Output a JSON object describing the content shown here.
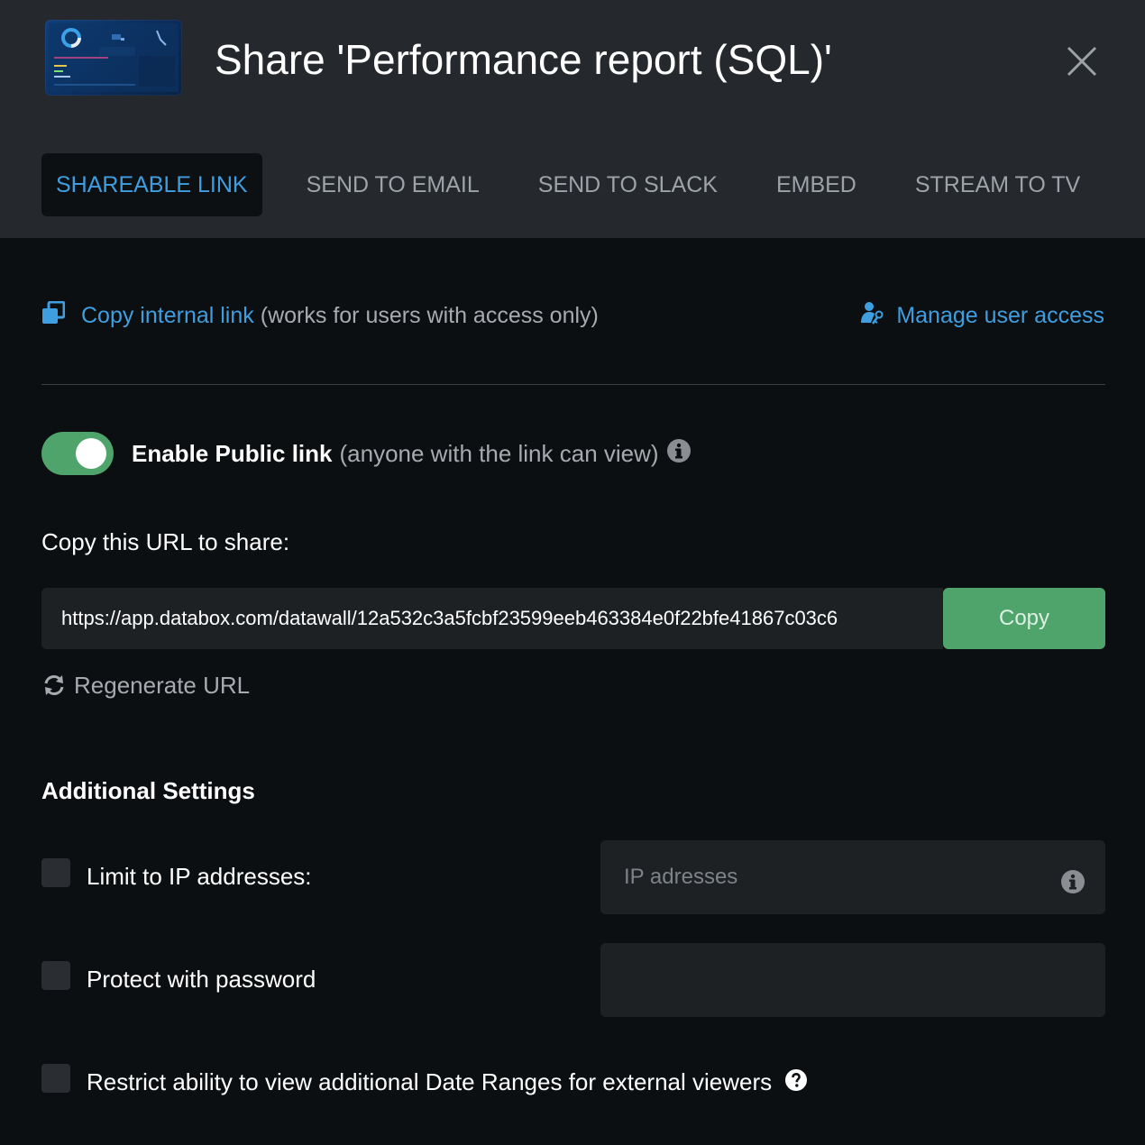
{
  "dialog": {
    "title": "Share 'Performance report (SQL)'",
    "close_icon": "close-icon",
    "thumbnail_icon": "dashboard-thumbnail"
  },
  "tabs": [
    {
      "label": "SHAREABLE LINK",
      "active": true
    },
    {
      "label": "SEND TO EMAIL",
      "active": false
    },
    {
      "label": "SEND TO SLACK",
      "active": false
    },
    {
      "label": "EMBED",
      "active": false
    },
    {
      "label": "STREAM TO TV",
      "active": false
    }
  ],
  "internal": {
    "link_label": "Copy internal link",
    "note": "(works for users with access only)",
    "icon": "copy-icon",
    "manage_label": "Manage user access",
    "manage_icon": "user-key-icon"
  },
  "public_link": {
    "enabled": true,
    "label": "Enable Public link",
    "note": "(anyone with the link can view)",
    "info_icon": "info-icon",
    "copy_url_label": "Copy this URL to share:",
    "url": "https://app.databox.com/datawall/12a532c3a5fcbf23599eeb463384e0f22bfe41867c03c6",
    "copy_button": "Copy",
    "regenerate_label": "Regenerate URL",
    "regenerate_icon": "refresh-icon"
  },
  "additional": {
    "heading": "Additional Settings",
    "ip_limit": {
      "label": "Limit to IP addresses:",
      "checked": false,
      "placeholder": "IP adresses",
      "value": "",
      "info_icon": "info-icon"
    },
    "password": {
      "label": "Protect with password",
      "checked": false,
      "value": ""
    },
    "restrict_dates": {
      "label": "Restrict ability to view additional Date Ranges for external viewers",
      "checked": false,
      "help_icon": "question-icon"
    }
  },
  "colors": {
    "header_bg": "#25282d",
    "body_bg": "#0c0f11",
    "accent_blue": "#3f9ee0",
    "accent_green": "#4fa46c",
    "field_bg": "#1e2124"
  }
}
